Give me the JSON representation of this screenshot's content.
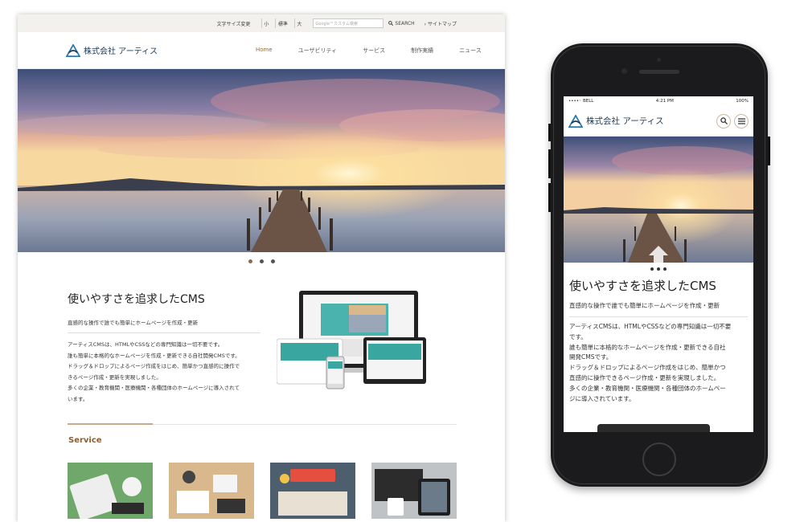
{
  "desktop": {
    "topbar": {
      "font_size_label": "文字サイズ変更",
      "font_sizes": [
        "小",
        "標準",
        "大"
      ],
      "search_placeholder": "Google™カスタム検索",
      "search_button": "SEARCH",
      "sitemap": "サイトマップ"
    },
    "header": {
      "logo_text": "株式会社 アーティス",
      "nav": [
        "Home",
        "ユーザビリティ",
        "サービス",
        "制作実績",
        "ニュース"
      ]
    },
    "intro": {
      "title": "使いやすさを追求したCMS",
      "subtitle": "直感的な操作で誰でも簡単にホームページを作成・更新",
      "body": [
        "アーティスCMSは、HTMLやCSSなどの専門知識は一切不要です。",
        "誰も簡単に本格的なホームページを作成・更新できる自社開発CMSです。",
        "ドラッグ＆ドロップによるページ作成をはじめ、簡単かつ直感的に操作で",
        "きるページ作成・更新を実現しました。",
        "多くの企業・教育機関・医療機関・各種団体のホームページに導入されて",
        "います。"
      ]
    },
    "service": {
      "title": "Service"
    },
    "colors": {
      "accent": "#8b5e34",
      "nav_active": "#9b6a3c",
      "logo": "#1e3a52"
    }
  },
  "mobile": {
    "status": {
      "carrier": "••••◦ BELL",
      "time": "4:21 PM",
      "battery": "100%"
    },
    "logo_text": "株式会社 アーティス",
    "title": "使いやすさを追求したCMS",
    "subtitle": "直感的な操作で誰でも簡単にホームページを作成・更新",
    "body": [
      "アーティスCMSは、HTMLやCSSなどの専門知識は一切不要",
      "です。",
      "誰も簡単に本格的なホームページを作成・更新できる自社",
      "開発CMSです。",
      "ドラッグ＆ドロップによるページ作成をはじめ、簡単かつ",
      "直感的に操作できるページ作成・更新を実現しました。",
      "多くの企業・教育機関・医療機関・各種団体のホームペー",
      "ジに導入されています。"
    ]
  }
}
